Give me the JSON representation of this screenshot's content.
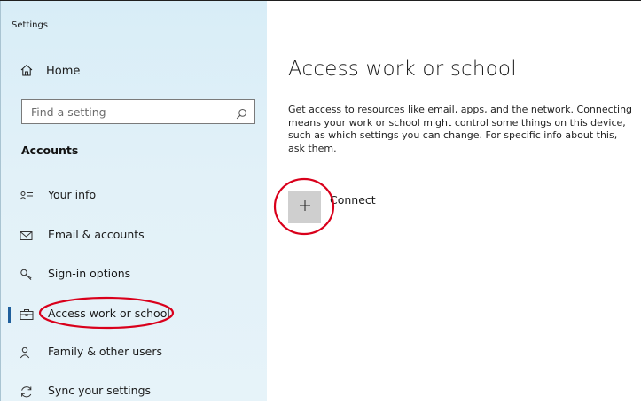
{
  "window": {
    "title": "Settings"
  },
  "sidebar": {
    "home": {
      "label": "Home",
      "icon": "home-icon"
    },
    "search": {
      "placeholder": "Find a setting",
      "icon": "search-icon"
    },
    "section_title": "Accounts",
    "items": [
      {
        "label": "Your info",
        "icon": "person-card-icon"
      },
      {
        "label": "Email & accounts",
        "icon": "mail-icon"
      },
      {
        "label": "Sign-in options",
        "icon": "key-icon"
      },
      {
        "label": "Access work or school",
        "icon": "briefcase-icon",
        "selected": true
      },
      {
        "label": "Family & other users",
        "icon": "person-add-icon"
      },
      {
        "label": "Sync your settings",
        "icon": "sync-icon"
      }
    ]
  },
  "main": {
    "title": "Access work or school",
    "description": "Get access to resources like email, apps, and the network. Connecting means your work or school might control some things on this device, such as which settings you can change. For specific info about this, ask them.",
    "connect": {
      "label": "Connect",
      "icon": "plus-icon"
    }
  },
  "colors": {
    "sidebar_bg": "#d8edf7",
    "selection_accent": "#1f5f9c",
    "annotation": "#d9001b",
    "tile": "#cfcfcf"
  }
}
